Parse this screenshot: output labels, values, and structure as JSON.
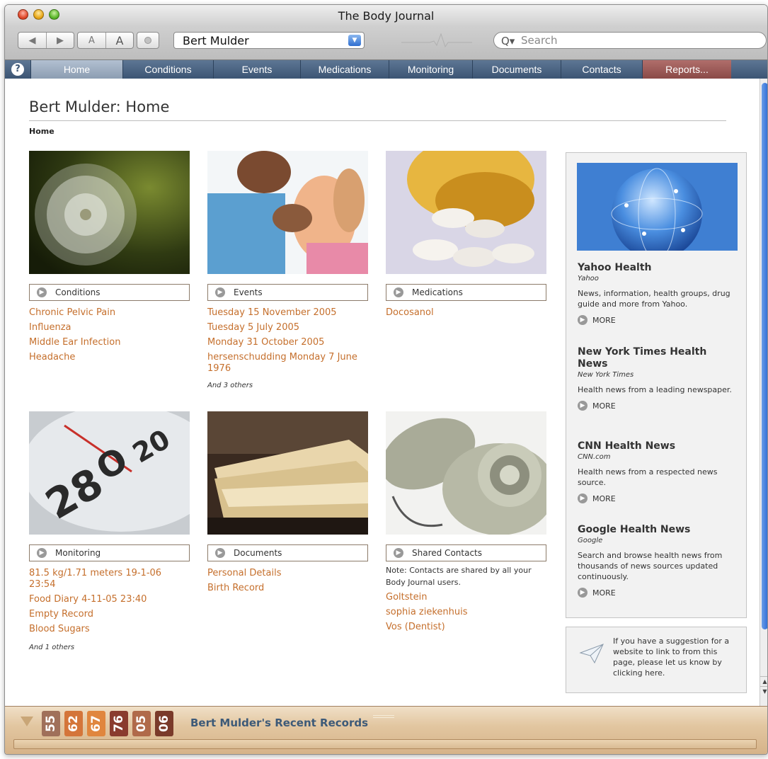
{
  "window": {
    "title": "The Body Journal"
  },
  "toolbar": {
    "back_label": "◀",
    "forward_label": "▶",
    "font_small": "A",
    "font_large": "A",
    "patient": "Bert Mulder",
    "search_placeholder": "Search"
  },
  "tabs": {
    "help": "?",
    "items": [
      "Home",
      "Conditions",
      "Events",
      "Medications",
      "Monitoring",
      "Documents",
      "Contacts",
      "Reports..."
    ]
  },
  "page": {
    "title": "Bert Mulder: Home",
    "breadcrumb": "Home"
  },
  "sections": {
    "conditions": {
      "heading": "Conditions",
      "items": [
        "Chronic Pelvic Pain",
        "Influenza",
        "Middle Ear Infection",
        "Headache"
      ]
    },
    "events": {
      "heading": "Events",
      "items": [
        "Tuesday 15 November 2005",
        "Tuesday 5 July 2005",
        "Monday 31 October 2005",
        "hersenschudding Monday 7 June 1976"
      ],
      "others": "And 3 others"
    },
    "medications": {
      "heading": "Medications",
      "items": [
        "Docosanol"
      ]
    },
    "monitoring": {
      "heading": "Monitoring",
      "items": [
        "81.5 kg/1.71 meters 19-1-06 23:54",
        "Food Diary 4-11-05 23:40",
        "Empty Record",
        "Blood Sugars"
      ],
      "others": "And 1 others"
    },
    "documents": {
      "heading": "Documents",
      "items": [
        "Personal Details",
        "Birth Record"
      ]
    },
    "contacts": {
      "heading": "Shared Contacts",
      "note": "Note: Contacts are shared by all your Body Journal users.",
      "items": [
        "Goltstein",
        "sophia ziekenhuis",
        "Vos (Dentist)"
      ]
    }
  },
  "sidebar": {
    "feeds": [
      {
        "title": "Yahoo Health",
        "source": "Yahoo",
        "desc": "News, information, health groups, drug guide and more from Yahoo.",
        "more": "MORE"
      },
      {
        "title": "New York Times Health News",
        "source": "New York Times",
        "desc": "Health news from a leading newspaper.",
        "more": "MORE"
      },
      {
        "title": "CNN Health News",
        "source": "CNN.com",
        "desc": "Health news from a respected news source.",
        "more": "MORE"
      },
      {
        "title": "Google Health News",
        "source": "Google",
        "desc": "Search and browse health news from thousands of news sources updated continuously.",
        "more": "MORE"
      }
    ],
    "suggestion": "If you have a suggestion for a website to link to from this page, please let us know by clicking here."
  },
  "drawer": {
    "label": "Bert Mulder's Recent Records",
    "records": [
      {
        "num": "55",
        "color": "#a0705a"
      },
      {
        "num": "62",
        "color": "#d4753a"
      },
      {
        "num": "67",
        "color": "#e0863e"
      },
      {
        "num": "76",
        "color": "#8a3b2e"
      },
      {
        "num": "05",
        "color": "#b06a4a"
      },
      {
        "num": "06",
        "color": "#7a3a2a"
      }
    ]
  },
  "colors": {
    "link": "#c56f2c",
    "tab_bar": "#3c5574",
    "reports_tab": "#8a4a47",
    "drawer": "#e2c6a0"
  }
}
